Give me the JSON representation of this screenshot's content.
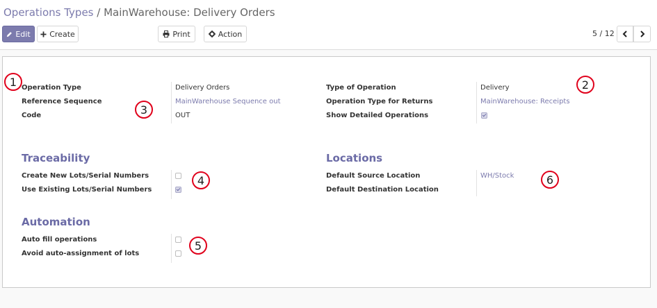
{
  "breadcrumb": {
    "parent": "Operations Types",
    "separator": " / ",
    "current": "MainWarehouse: Delivery Orders"
  },
  "toolbar": {
    "edit_label": "Edit",
    "create_label": "Create",
    "print_label": "Print",
    "action_label": "Action"
  },
  "pager": {
    "value": "5 / 12"
  },
  "form": {
    "operation_type": {
      "label": "Operation Type",
      "value": "Delivery Orders"
    },
    "reference_sequence": {
      "label": "Reference Sequence",
      "value": "MainWarehouse Sequence out"
    },
    "code": {
      "label": "Code",
      "value": "OUT"
    },
    "type_of_operation": {
      "label": "Type of Operation",
      "value": "Delivery"
    },
    "return_type": {
      "label": "Operation Type for Returns",
      "value": "MainWarehouse: Receipts"
    },
    "show_detailed": {
      "label": "Show Detailed Operations",
      "checked": true
    },
    "traceability": {
      "title": "Traceability",
      "create_lots": {
        "label": "Create New Lots/Serial Numbers",
        "checked": false
      },
      "use_existing": {
        "label": "Use Existing Lots/Serial Numbers",
        "checked": true
      }
    },
    "locations": {
      "title": "Locations",
      "default_source": {
        "label": "Default Source Location",
        "value": "WH/Stock"
      },
      "default_destination": {
        "label": "Default Destination Location",
        "value": ""
      }
    },
    "automation": {
      "title": "Automation",
      "auto_fill": {
        "label": "Auto fill operations",
        "checked": false
      },
      "avoid_auto_assign": {
        "label": "Avoid auto-assignment of lots",
        "checked": false
      }
    }
  },
  "annotations": [
    "1",
    "2",
    "3",
    "4",
    "5",
    "6"
  ],
  "colors": {
    "accent": "#7c7bad",
    "marker": "#e0001b"
  }
}
